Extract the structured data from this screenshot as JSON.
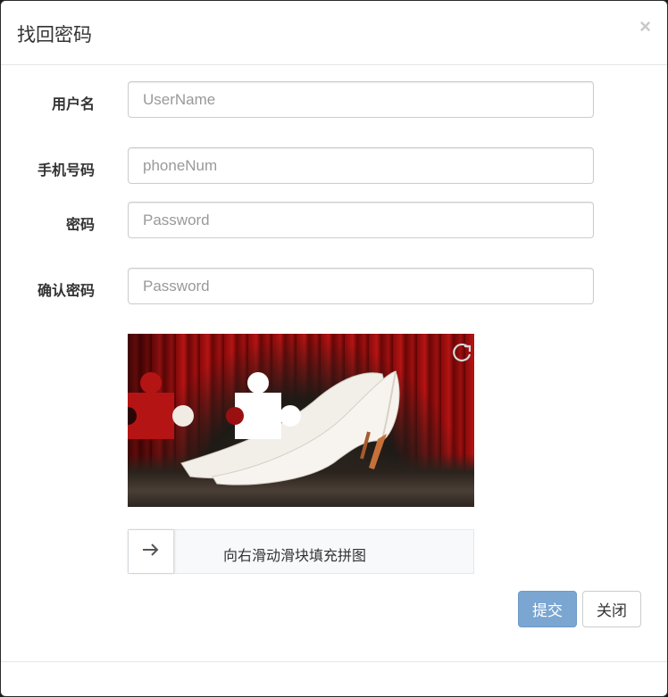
{
  "dialog": {
    "title": "找回密码",
    "close_glyph": "×"
  },
  "fields": [
    {
      "label": "用户名",
      "placeholder": "UserName"
    },
    {
      "label": "手机号码",
      "placeholder": "phoneNum"
    },
    {
      "label": "密码",
      "placeholder": "Password"
    },
    {
      "label": "确认密码",
      "placeholder": "Password"
    }
  ],
  "captcha": {
    "refresh_icon": "refresh-icon",
    "slider_icon": "arrow-right-icon",
    "slider_text": "向右滑动滑块填充拼图"
  },
  "buttons": {
    "submit_label": "提交",
    "close_label": "关闭"
  },
  "colors": {
    "primary": "#7aa6d1",
    "captcha_red": "#b51414"
  }
}
